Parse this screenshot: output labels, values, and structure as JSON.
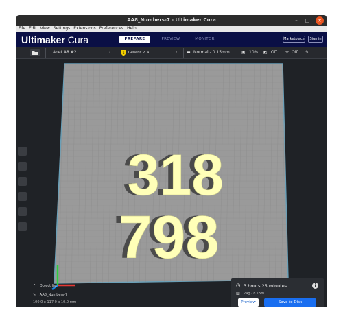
{
  "window": {
    "title": "AA8_Numbers-7 - Ultimaker Cura",
    "controls": {
      "minimize": "–",
      "maximize": "□",
      "close": "✕"
    }
  },
  "menu": {
    "items": [
      "File",
      "Edit",
      "View",
      "Settings",
      "Extensions",
      "Preferences",
      "Help"
    ]
  },
  "header": {
    "logo_brand": "Ultimaker",
    "logo_product": "Cura",
    "tabs": [
      "PREPARE",
      "PREVIEW",
      "MONITOR"
    ],
    "marketplace": "Marketplace",
    "signin": "Sign in"
  },
  "stage": {
    "printer": "Anet A8 #2",
    "material": "Generic PLA",
    "profile": "Normal - 0.15mm",
    "infill": "10%",
    "support": "Off",
    "adhesion": "Off"
  },
  "model": {
    "line1": "318",
    "line2": "798"
  },
  "object_panel": {
    "title": "Object list",
    "filename": "AA8_Numbers-7",
    "dims": "100.0 x 117.0 x 10.0 mm"
  },
  "job": {
    "time": "3 hours 25 minutes",
    "material": "24g · 8.15m",
    "preview_btn": "Preview",
    "save_btn": "Save to Disk"
  },
  "colors": {
    "header": "#0a0f45",
    "plate": "#9a9a9a",
    "model": "#ffffb8",
    "accent": "#196ef0"
  }
}
